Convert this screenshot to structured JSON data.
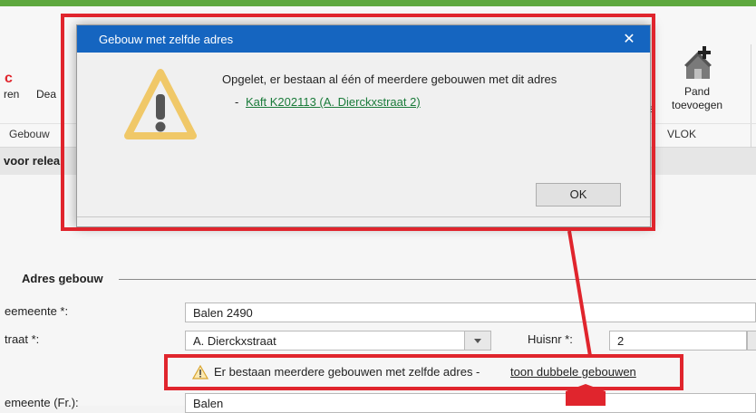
{
  "ribbon": {
    "left_partial_1": "ren",
    "left_partial_2": "Dea",
    "group_gebouw": "Gebouw",
    "s_partial": "s",
    "pand_label_1": "Pand",
    "pand_label_2": "toevoegen",
    "group_vlok": "VLOK"
  },
  "infobar": {
    "text": "voor relea"
  },
  "dialog": {
    "title": "Gebouw met zelfde adres",
    "close_glyph": "✕",
    "message": "Opgelet, er bestaan al één of meerdere gebouwen met dit adres",
    "list_dash": "-",
    "link_text": "Kaft K202113 (A. Dierckxstraat 2)",
    "ok_label": "OK"
  },
  "form": {
    "section_title": "Adres gebouw",
    "gemeente_label": "eemeente *:",
    "gemeente_value": "Balen 2490",
    "straat_label": "traat *:",
    "straat_value": "A. Dierckxstraat",
    "huisnr_label": "Huisnr *:",
    "huisnr_value": "2",
    "warning_text": "Er bestaan meerdere gebouwen met zelfde adres -",
    "warning_link": "toon dubbele gebouwen",
    "gemeente_fr_label": "emeente (Fr.):",
    "gemeente_fr_value": "Balen"
  },
  "colors": {
    "title_bar": "#1565c0",
    "highlight_red": "#e0252d",
    "top_bar_green": "#5ea83f",
    "link_green": "#1a7b3a",
    "warning_yellow": "#f2c14e"
  }
}
